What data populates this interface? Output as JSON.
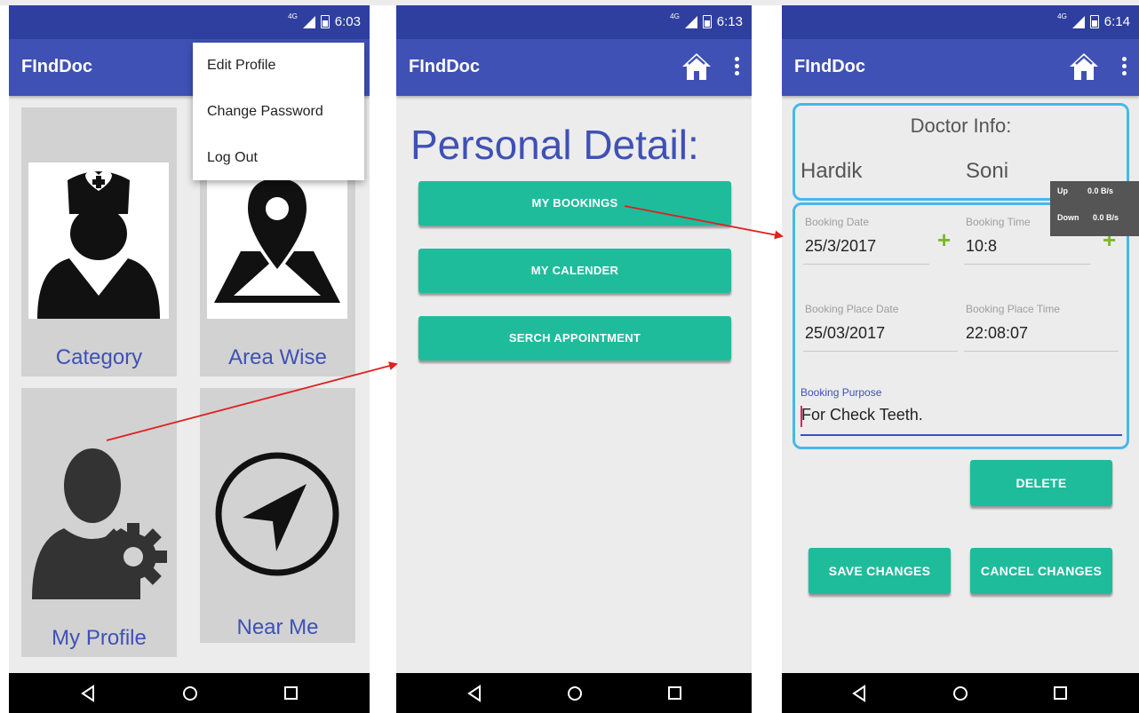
{
  "screens": [
    {
      "time": "6:03",
      "network": "4G",
      "app_title": "FIndDoc",
      "menu": [
        "Edit Profile",
        "Change Password",
        "Log Out"
      ],
      "tiles": [
        {
          "label": "Category",
          "icon": "doctor-nurse-icon"
        },
        {
          "label": "Area Wise",
          "icon": "map-pin-icon"
        },
        {
          "label": "My Profile",
          "icon": "user-settings-icon"
        },
        {
          "label": "Near Me",
          "icon": "navigation-compass-icon"
        }
      ]
    },
    {
      "time": "6:13",
      "network": "4G",
      "app_title": "FIndDoc",
      "heading": "Personal Detail:",
      "buttons": [
        "MY BOOKINGS",
        "MY CALENDER",
        "SERCH APPOINTMENT"
      ]
    },
    {
      "time": "6:14",
      "network": "4G",
      "app_title": "FIndDoc",
      "doctor_info": {
        "title": "Doctor Info:",
        "first_name": "Hardik",
        "last_name": "Soni"
      },
      "net_speed": {
        "up_label": "Up",
        "up_value": "0.0 B/s",
        "down_label": "Down",
        "down_value": "0.0 B/s"
      },
      "booking": {
        "date_label": "Booking Date",
        "date_value": "25/3/2017",
        "time_label": "Booking Time",
        "time_value": "10:8",
        "place_date_label": "Booking Place Date",
        "place_date_value": "25/03/2017",
        "place_time_label": "Booking Place Time",
        "place_time_value": "22:08:07",
        "purpose_label": "Booking Purpose",
        "purpose_value": "For Check Teeth."
      },
      "buttons": {
        "delete": "DELETE",
        "save": "SAVE CHANGES",
        "cancel": "CANCEL CHANGES"
      }
    }
  ],
  "colors": {
    "status_bar": "#2f3f9f",
    "app_bar": "#3f51b5",
    "accent_button": "#1fbc9c",
    "card_border": "#45b8ea",
    "arrow": "#e02020",
    "plus_icon": "#7cb82f"
  }
}
